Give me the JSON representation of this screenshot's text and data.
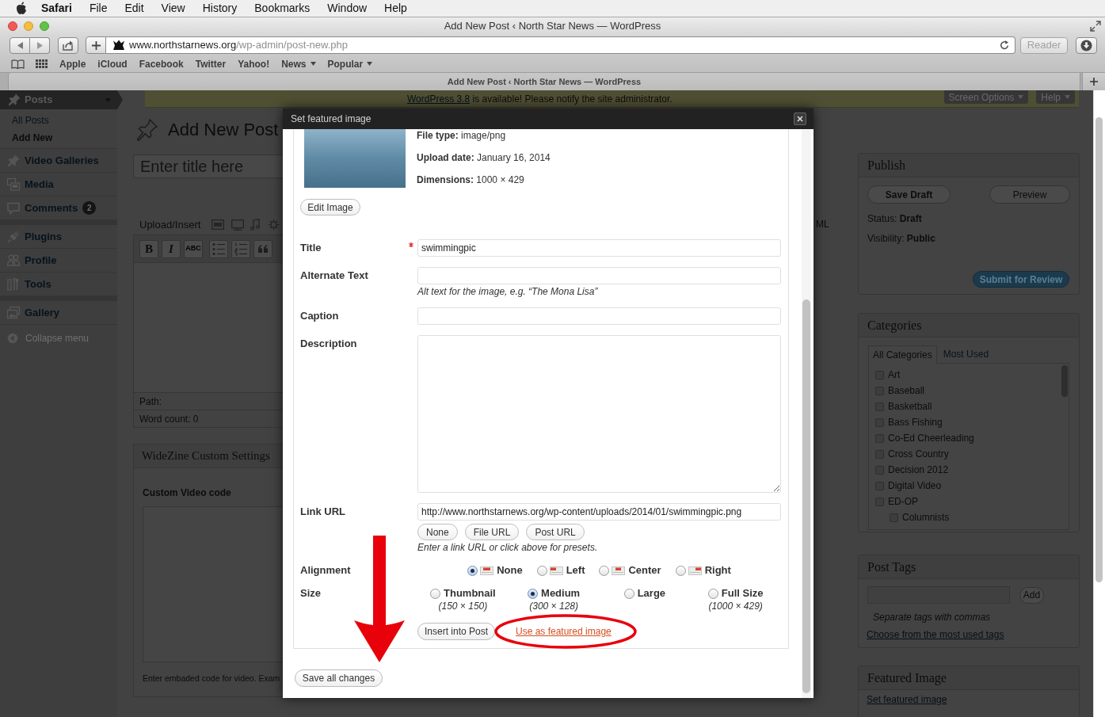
{
  "menu_bar": {
    "app": "Safari",
    "items": [
      "File",
      "Edit",
      "View",
      "History",
      "Bookmarks",
      "Window",
      "Help"
    ]
  },
  "browser": {
    "title": "Add New Post ‹ North Star News — WordPress",
    "url": {
      "host": "www.northstarnews.org",
      "path": "/wp-admin/post-new.php"
    },
    "reader": "Reader",
    "bookmarks": [
      {
        "label": "Apple",
        "menu": false
      },
      {
        "label": "iCloud",
        "menu": false
      },
      {
        "label": "Facebook",
        "menu": false
      },
      {
        "label": "Twitter",
        "menu": false
      },
      {
        "label": "Yahoo!",
        "menu": false
      },
      {
        "label": "News",
        "menu": true
      },
      {
        "label": "Popular",
        "menu": true
      }
    ],
    "tab_title": "Add New Post ‹ North Star News — WordPress"
  },
  "admin_menu": {
    "groups": [
      [
        {
          "label": "Posts",
          "current": true,
          "children": [
            {
              "label": "All Posts",
              "selected": false
            },
            {
              "label": "Add New",
              "selected": true
            }
          ]
        },
        {
          "label": "Video Galleries",
          "current": false
        },
        {
          "label": "Media",
          "current": false
        },
        {
          "label": "Comments",
          "current": false,
          "badge": "2"
        }
      ],
      [
        {
          "label": "Plugins",
          "current": false
        },
        {
          "label": "Profile",
          "current": false
        },
        {
          "label": "Tools",
          "current": false
        }
      ],
      [
        {
          "label": "Gallery",
          "current": false
        }
      ]
    ],
    "collapse": "Collapse menu"
  },
  "notice": {
    "link": "WordPress 3.8",
    "text": "is available! Please notify the site administrator."
  },
  "screen_tabs": [
    "Screen Options",
    "Help"
  ],
  "editor": {
    "heading": "Add New Post",
    "title_placeholder": "Enter title here",
    "upload_label": "Upload/Insert",
    "view_tab": "ML",
    "format_buttons": [
      "B",
      "I",
      "ABC"
    ],
    "path": "Path:",
    "word_count": "Word count: 0"
  },
  "custom_settings": {
    "title": "WideZine Custom Settings",
    "field_label": "Custom Video code",
    "help": "Enter embaded code for video. Exam"
  },
  "publish": {
    "title": "Publish",
    "save_draft": "Save Draft",
    "preview": "Preview",
    "status": "Status: **Draft**",
    "visibility": "Visibility: **Public**",
    "submit": "Submit for Review"
  },
  "categories": {
    "title": "Categories",
    "tabs": [
      {
        "label": "All Categories",
        "selected": true
      },
      {
        "label": "Most Used",
        "selected": false
      }
    ],
    "items": [
      {
        "label": "Art",
        "checked": false
      },
      {
        "label": "Baseball",
        "checked": false
      },
      {
        "label": "Basketball",
        "checked": false
      },
      {
        "label": "Bass Fishing",
        "checked": false
      },
      {
        "label": "Co-Ed Cheerleading",
        "checked": false
      },
      {
        "label": "Cross Country",
        "checked": false
      },
      {
        "label": "Decision 2012",
        "checked": false
      },
      {
        "label": "Digital Video",
        "checked": false
      },
      {
        "label": "ED-OP",
        "checked": false,
        "children": [
          {
            "label": "Columnists",
            "checked": false
          }
        ]
      }
    ]
  },
  "post_tags": {
    "title": "Post Tags",
    "add": "Add",
    "hint": "Separate tags with commas",
    "link": "Choose from the most used tags"
  },
  "featured_image": {
    "title": "Featured Image",
    "link": "Set featured image"
  },
  "dialog": {
    "title": "Set featured image",
    "file_info": [
      "**File type:** image/png",
      "**Upload date:** January 16, 2014",
      "**Dimensions:** 1000 × 429"
    ],
    "edit_button": "Edit Image",
    "fields": [
      {
        "label": "Title",
        "required": true,
        "kind": "input",
        "value": "swimmingpic"
      },
      {
        "label": "Alternate Text",
        "required": false,
        "kind": "input",
        "help": "Alt text for the image, e.g. “The Mona Lisa”"
      },
      {
        "label": "Caption",
        "required": false,
        "kind": "input"
      },
      {
        "label": "Description",
        "required": false,
        "kind": "textarea"
      },
      {
        "label": "Link URL",
        "required": false,
        "kind": "input",
        "value": "http://www.northstarnews.org/wp-content/uploads/2014/01/swimmingpic.png",
        "presets": [
          "None",
          "File URL",
          "Post URL"
        ],
        "help": "Enter a link URL or click above for presets."
      }
    ],
    "alignment": {
      "label": "Alignment",
      "options": [
        {
          "label": "None",
          "selected": true
        },
        {
          "label": "Left",
          "selected": false
        },
        {
          "label": "Center",
          "selected": false
        },
        {
          "label": "Right",
          "selected": false
        }
      ]
    },
    "size": {
      "label": "Size",
      "options": [
        {
          "label": "Thumbnail",
          "dims": "(150 × 150)",
          "selected": false
        },
        {
          "label": "Medium",
          "dims": "(300 × 128)",
          "selected": true
        },
        {
          "label": "Large",
          "selected": false
        },
        {
          "label": "Full Size",
          "dims": "(1000 × 429)",
          "selected": false
        }
      ]
    },
    "insert_button": "Insert into Post",
    "featured_link": "Use as featured image",
    "save_button": "Save all changes"
  }
}
